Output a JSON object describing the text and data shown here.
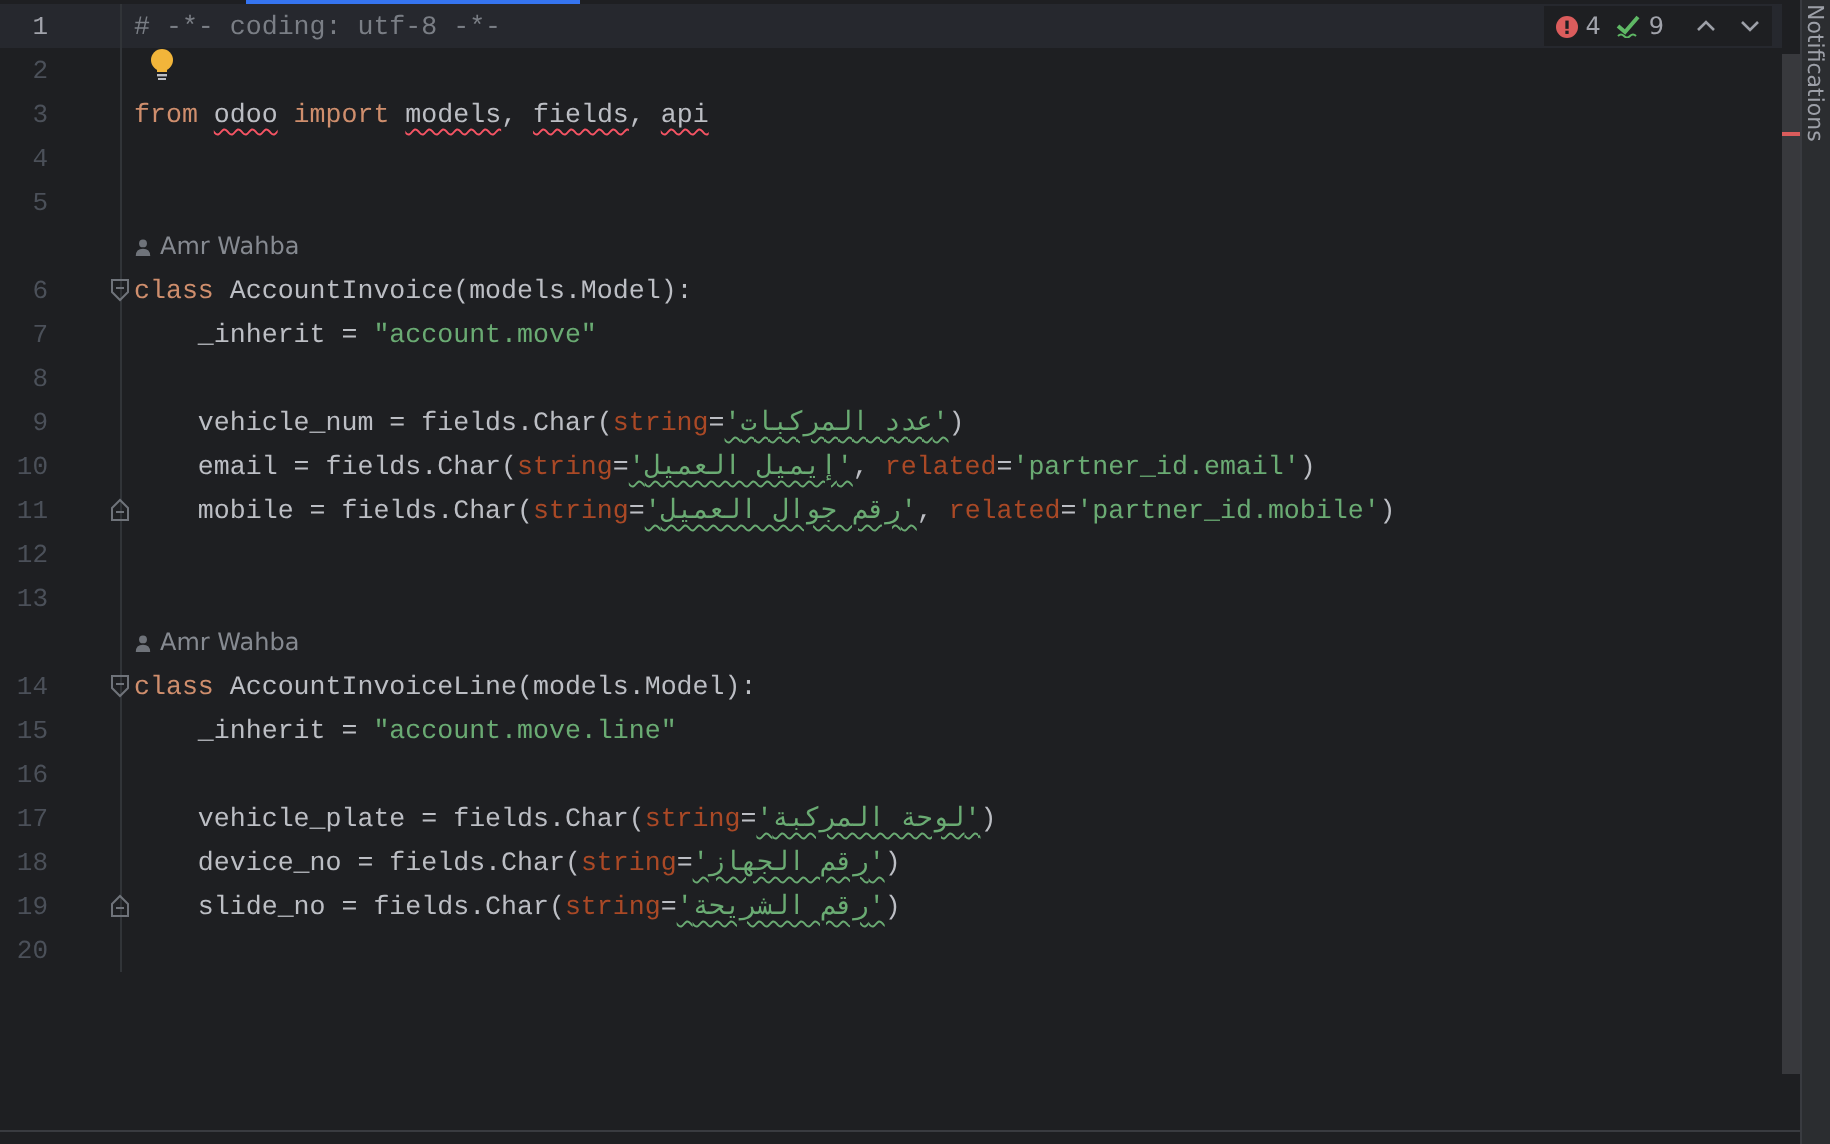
{
  "editor": {
    "rows": [
      {
        "kind": "code",
        "number": "1",
        "selected": true,
        "tokens": [
          {
            "kind": "comment",
            "text": "# -*- coding: utf-8 -*-"
          }
        ]
      },
      {
        "kind": "code",
        "number": "2",
        "selected": false,
        "tokens": [
          {
            "kind": "bulb"
          }
        ]
      },
      {
        "kind": "code",
        "number": "3",
        "selected": false,
        "tokens": [
          {
            "kind": "keyword",
            "text": "from "
          },
          {
            "kind": "unresolved",
            "text": "odoo"
          },
          {
            "kind": "keyword",
            "text": " import "
          },
          {
            "kind": "unresolved",
            "text": "models"
          },
          {
            "kind": "plain",
            "text": ", "
          },
          {
            "kind": "unresolved",
            "text": "fields"
          },
          {
            "kind": "plain",
            "text": ", "
          },
          {
            "kind": "unresolved",
            "text": "api"
          }
        ]
      },
      {
        "kind": "code",
        "number": "4",
        "selected": false,
        "tokens": []
      },
      {
        "kind": "code",
        "number": "5",
        "selected": false,
        "tokens": []
      },
      {
        "kind": "author",
        "text": "Amr Wahba"
      },
      {
        "kind": "fold_start",
        "number": "6",
        "selected": false,
        "tokens": [
          {
            "kind": "keyword",
            "text": "class"
          },
          {
            "kind": "plain",
            "text": " AccountInvoice(models.Model):"
          }
        ]
      },
      {
        "kind": "code",
        "number": "7",
        "selected": false,
        "tokens": [
          {
            "kind": "plain",
            "text": "    _inherit = "
          },
          {
            "kind": "string",
            "text": "\"account.move\""
          }
        ]
      },
      {
        "kind": "code",
        "number": "8",
        "selected": false,
        "tokens": []
      },
      {
        "kind": "code",
        "number": "9",
        "selected": false,
        "tokens": [
          {
            "kind": "plain",
            "text": "    vehicle_num = fields.Char("
          },
          {
            "kind": "param",
            "text": "string"
          },
          {
            "kind": "plain",
            "text": "="
          },
          {
            "kind": "typo_string",
            "text": "'عدد المركبات'"
          },
          {
            "kind": "plain",
            "text": ")"
          }
        ]
      },
      {
        "kind": "code",
        "number": "10",
        "selected": false,
        "tokens": [
          {
            "kind": "plain",
            "text": "    email = fields.Char("
          },
          {
            "kind": "param",
            "text": "string"
          },
          {
            "kind": "plain",
            "text": "="
          },
          {
            "kind": "typo_string",
            "text": "'إيميل العميل'"
          },
          {
            "kind": "plain",
            "text": ", "
          },
          {
            "kind": "param",
            "text": "related"
          },
          {
            "kind": "plain",
            "text": "="
          },
          {
            "kind": "string",
            "text": "'partner_id.email'"
          },
          {
            "kind": "plain",
            "text": ")"
          }
        ]
      },
      {
        "kind": "fold_end",
        "number": "11",
        "selected": false,
        "tokens": [
          {
            "kind": "plain",
            "text": "    mobile = fields.Char("
          },
          {
            "kind": "param",
            "text": "string"
          },
          {
            "kind": "plain",
            "text": "="
          },
          {
            "kind": "typo_string",
            "text": "'رقم جوال العميل'"
          },
          {
            "kind": "plain",
            "text": ", "
          },
          {
            "kind": "param",
            "text": "related"
          },
          {
            "kind": "plain",
            "text": "="
          },
          {
            "kind": "string",
            "text": "'partner_id.mobile'"
          },
          {
            "kind": "plain",
            "text": ")"
          }
        ]
      },
      {
        "kind": "code",
        "number": "12",
        "selected": false,
        "tokens": []
      },
      {
        "kind": "code",
        "number": "13",
        "selected": false,
        "tokens": []
      },
      {
        "kind": "author",
        "text": "Amr Wahba"
      },
      {
        "kind": "fold_start",
        "number": "14",
        "selected": false,
        "tokens": [
          {
            "kind": "keyword",
            "text": "class"
          },
          {
            "kind": "plain",
            "text": " AccountInvoiceLine(models.Model):"
          }
        ]
      },
      {
        "kind": "code",
        "number": "15",
        "selected": false,
        "tokens": [
          {
            "kind": "plain",
            "text": "    _inherit = "
          },
          {
            "kind": "string",
            "text": "\"account.move.line\""
          }
        ]
      },
      {
        "kind": "code",
        "number": "16",
        "selected": false,
        "tokens": []
      },
      {
        "kind": "code",
        "number": "17",
        "selected": false,
        "tokens": [
          {
            "kind": "plain",
            "text": "    vehicle_plate = fields.Char("
          },
          {
            "kind": "param",
            "text": "string"
          },
          {
            "kind": "plain",
            "text": "="
          },
          {
            "kind": "typo_string",
            "text": "'لوحة المركبة'"
          },
          {
            "kind": "plain",
            "text": ")"
          }
        ]
      },
      {
        "kind": "code",
        "number": "18",
        "selected": false,
        "tokens": [
          {
            "kind": "plain",
            "text": "    device_no = fields.Char("
          },
          {
            "kind": "param",
            "text": "string"
          },
          {
            "kind": "plain",
            "text": "="
          },
          {
            "kind": "typo_string",
            "text": "'رقم الجهاز'"
          },
          {
            "kind": "plain",
            "text": ")"
          }
        ]
      },
      {
        "kind": "fold_end",
        "number": "19",
        "selected": false,
        "tokens": [
          {
            "kind": "plain",
            "text": "    slide_no = fields.Char("
          },
          {
            "kind": "param",
            "text": "string"
          },
          {
            "kind": "plain",
            "text": "="
          },
          {
            "kind": "typo_string",
            "text": "'رقم الشريحة'"
          },
          {
            "kind": "plain",
            "text": ")"
          }
        ]
      },
      {
        "kind": "code",
        "number": "20",
        "selected": false,
        "tokens": []
      }
    ]
  },
  "inspections": {
    "errors": "4",
    "warnings": "9"
  },
  "side_panel": {
    "label": "Notifications"
  }
}
